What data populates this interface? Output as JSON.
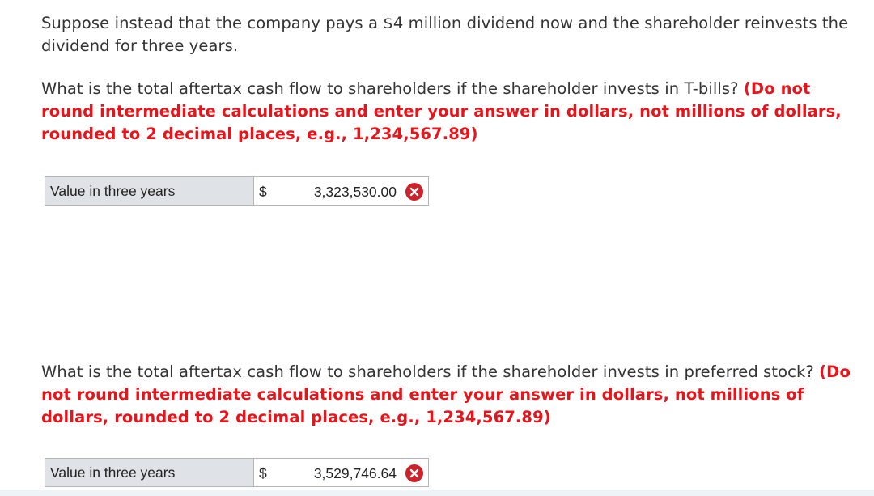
{
  "intro": "Suppose instead that the company pays a $4 million dividend now and the shareholder reinvests the dividend for three years.",
  "q1": {
    "question": "What is the total aftertax cash flow to shareholders if the shareholder invests in T-bills?",
    "instruction": "(Do not round intermediate calculations and enter your answer in dollars, not millions of dollars, rounded to 2 decimal places, e.g., 1,234,567.89)",
    "label": "Value in three years",
    "currency": "$",
    "value": "3,323,530.00",
    "status_icon": "incorrect-x-icon"
  },
  "q2": {
    "question": "What is the total aftertax cash flow to shareholders if the shareholder invests in preferred stock?",
    "instruction": "(Do not round intermediate calculations and enter your answer in dollars, not millions of dollars, rounded to 2 decimal places, e.g., 1,234,567.89)",
    "label": "Value in three years",
    "currency": "$",
    "value": "3,529,746.64",
    "status_icon": "incorrect-x-icon"
  },
  "colors": {
    "instruction": "#e8141a",
    "incorrect": "#cc2229",
    "label_bg": "#dfe2e7"
  }
}
